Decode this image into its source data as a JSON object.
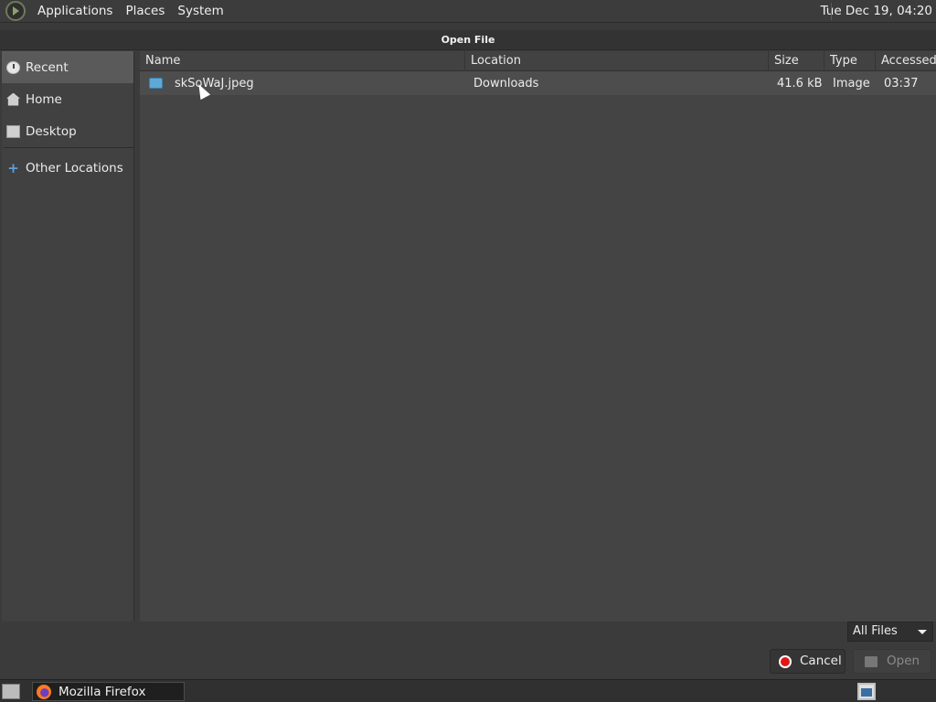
{
  "top_panel": {
    "menus": [
      "Applications",
      "Places",
      "System"
    ],
    "clock": "Tue Dec 19, 04:20"
  },
  "dialog": {
    "title": "Open File",
    "sidebar": [
      {
        "label": "Recent",
        "icon": "clock-icon",
        "active": true
      },
      {
        "label": "Home",
        "icon": "home-icon",
        "active": false
      },
      {
        "label": "Desktop",
        "icon": "desktop-icon",
        "active": false
      },
      {
        "label": "Other Locations",
        "icon": "plus-icon",
        "active": false
      }
    ],
    "columns": [
      "Name",
      "Location",
      "Size",
      "Type",
      "Accessed"
    ],
    "files": [
      {
        "name": "skSoWaJ.jpeg",
        "location": "Downloads",
        "size": "41.6 kB",
        "type": "Image",
        "accessed": "03:37",
        "icon": "image-file-icon"
      }
    ],
    "filter": "All Files",
    "cancel_label": "Cancel",
    "open_label": "Open"
  },
  "taskbar": {
    "task_label": "Mozilla Firefox",
    "task_icon": "firefox-icon"
  },
  "colors": {
    "cancel_icon": "#e31616",
    "file_icon": "#5ea8d6"
  }
}
